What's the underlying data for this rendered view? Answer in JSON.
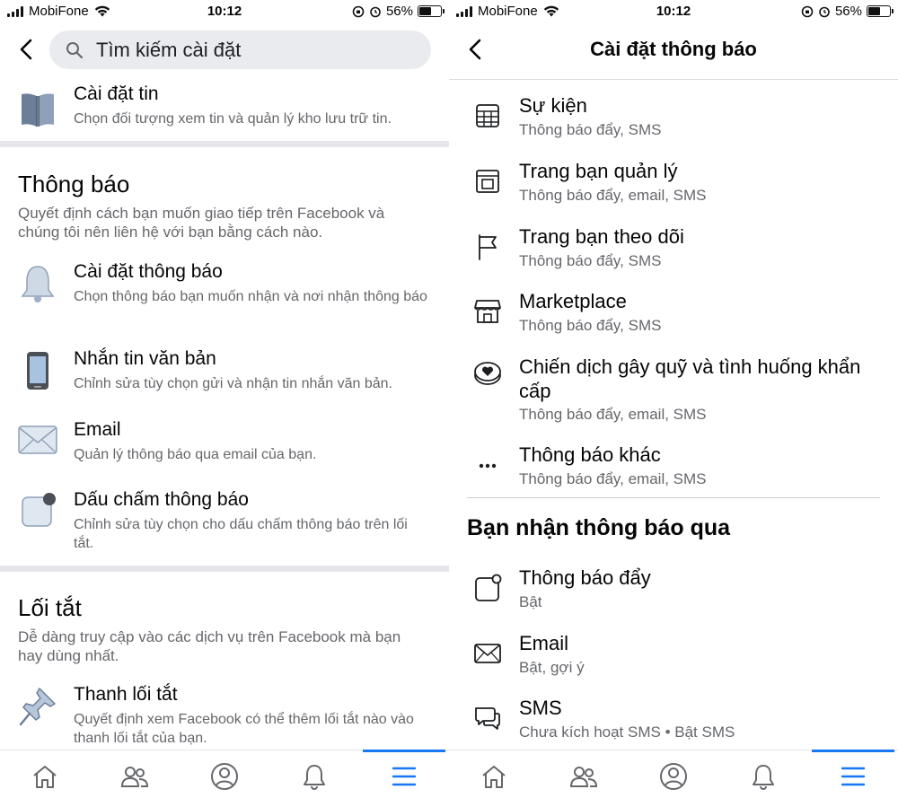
{
  "status_bar": {
    "carrier": "MobiFone",
    "time": "10:12",
    "battery": "56%",
    "battery_level": 0.56
  },
  "left_screen": {
    "search": {
      "placeholder": "Tìm kiếm cài đặt"
    },
    "top_item": {
      "title": "Cài đặt tin",
      "desc": "Chọn đối tượng xem tin và quản lý kho lưu trữ tin.",
      "icon": "book-icon"
    },
    "notifications_section": {
      "title": "Thông báo",
      "desc": "Quyết định cách bạn muốn giao tiếp trên Facebook và chúng tôi nên liên hệ với bạn bằng cách nào.",
      "items": [
        {
          "title": "Cài đặt thông báo",
          "desc": "Chọn thông báo bạn muốn nhận và nơi nhận thông báo",
          "icon": "bell-icon"
        },
        {
          "title": "Nhắn tin văn bản",
          "desc": "Chỉnh sửa tùy chọn gửi và nhận tin nhắn văn bản.",
          "icon": "phone-icon"
        },
        {
          "title": "Email",
          "desc": "Quản lý thông báo qua email của bạn.",
          "icon": "envelope-icon"
        },
        {
          "title": "Dấu chấm thông báo",
          "desc": "Chỉnh sửa tùy chọn cho dấu chấm thông báo trên lối tắt.",
          "icon": "notification-dot-icon"
        }
      ]
    },
    "shortcuts_section": {
      "title": "Lối tắt",
      "desc": "Dễ dàng truy cập vào các dịch vụ trên Facebook mà bạn hay dùng nhất.",
      "items": [
        {
          "title": "Thanh lối tắt",
          "desc": "Quyết định xem Facebook có thể thêm lối tắt nào vào thanh lối tắt của bạn.",
          "icon": "pushpin-icon"
        }
      ]
    }
  },
  "right_screen": {
    "title": "Cài đặt thông báo",
    "items": [
      {
        "title": "Sự kiện",
        "sub": "Thông báo đẩy, SMS",
        "icon": "calendar-icon"
      },
      {
        "title": "Trang bạn quản lý",
        "sub": "Thông báo đẩy, email, SMS",
        "icon": "page-icon"
      },
      {
        "title": "Trang bạn theo dõi",
        "sub": "Thông báo đẩy, SMS",
        "icon": "flag-icon"
      },
      {
        "title": "Marketplace",
        "sub": "Thông báo đẩy, SMS",
        "icon": "shop-icon"
      },
      {
        "title": "Chiến dịch gây quỹ và tình huống khẩn cấp",
        "sub": "Thông báo đẩy, email, SMS",
        "icon": "heart-coin-icon"
      },
      {
        "title": "Thông báo khác",
        "sub": "Thông báo đẩy, email, SMS",
        "icon": "more-icon"
      }
    ],
    "receive_section": {
      "title": "Bạn nhận thông báo qua",
      "items": [
        {
          "title": "Thông báo đẩy",
          "sub": "Bật",
          "icon": "push-icon"
        },
        {
          "title": "Email",
          "sub": "Bật, gợi ý",
          "icon": "envelope-icon"
        },
        {
          "title": "SMS",
          "sub": "Chưa kích hoạt SMS • Bật SMS",
          "icon": "chat-icon"
        }
      ]
    }
  },
  "tab_bar": {
    "tabs": [
      {
        "name": "home",
        "icon": "home-icon"
      },
      {
        "name": "friends",
        "icon": "friends-icon"
      },
      {
        "name": "profile",
        "icon": "profile-icon"
      },
      {
        "name": "notifications",
        "icon": "bell-icon"
      },
      {
        "name": "menu",
        "icon": "menu-icon",
        "active": true
      }
    ]
  },
  "colors": {
    "accent": "#1877f2",
    "secondary_text": "#65676b",
    "separator": "#e4e6eb",
    "search_bg": "#e9ebee"
  }
}
